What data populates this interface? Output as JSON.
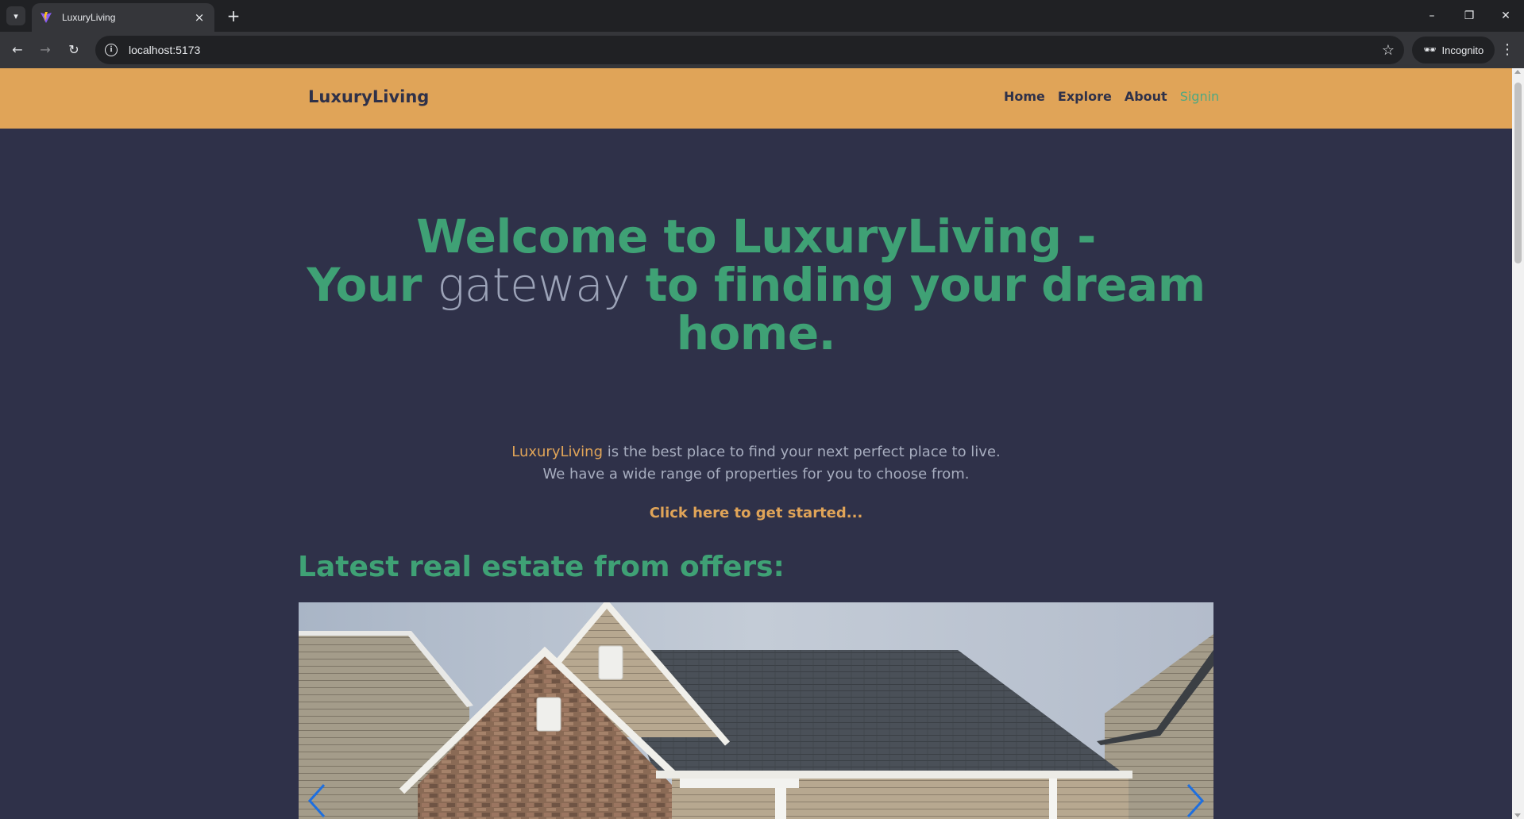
{
  "browser": {
    "tab_title": "LuxuryLiving",
    "tab_close": "×",
    "new_tab": "+",
    "url": "localhost:5173",
    "profile_label": "Incognito",
    "window_controls": {
      "minimize": "–",
      "restore": "❐",
      "close": "✕"
    }
  },
  "site": {
    "brand": "LuxuryLiving",
    "nav": {
      "home": "Home",
      "explore": "Explore",
      "about": "About",
      "signin": "Signin"
    },
    "hero": {
      "line1": "Welcome to LuxuryLiving -",
      "line2_a": "Your",
      "line2_b": "gateway",
      "line2_c": "to finding your dream",
      "line3": "home.",
      "tagline_brand": "LuxuryLiving",
      "tagline_rest": " is the best place to find your next perfect place to live.",
      "tagline_line2": "We have a wide range of properties for you to choose from.",
      "cta": "Click here to get started..."
    },
    "offers_title": "Latest real estate from offers:"
  },
  "colors": {
    "navbar_bg": "#e0a458",
    "page_bg": "#2f3149",
    "accent_green": "#3fa175",
    "accent_orange": "#e0a458"
  },
  "icons": {
    "tab_list": "chevron-down-icon",
    "back": "arrow-left-icon",
    "forward": "arrow-right-icon",
    "reload": "reload-icon",
    "site_info": "info-icon",
    "bookmark": "star-icon",
    "incognito": "incognito-icon",
    "menu": "kebab-menu-icon",
    "carousel_prev": "chevron-left-icon",
    "carousel_next": "chevron-right-icon"
  }
}
